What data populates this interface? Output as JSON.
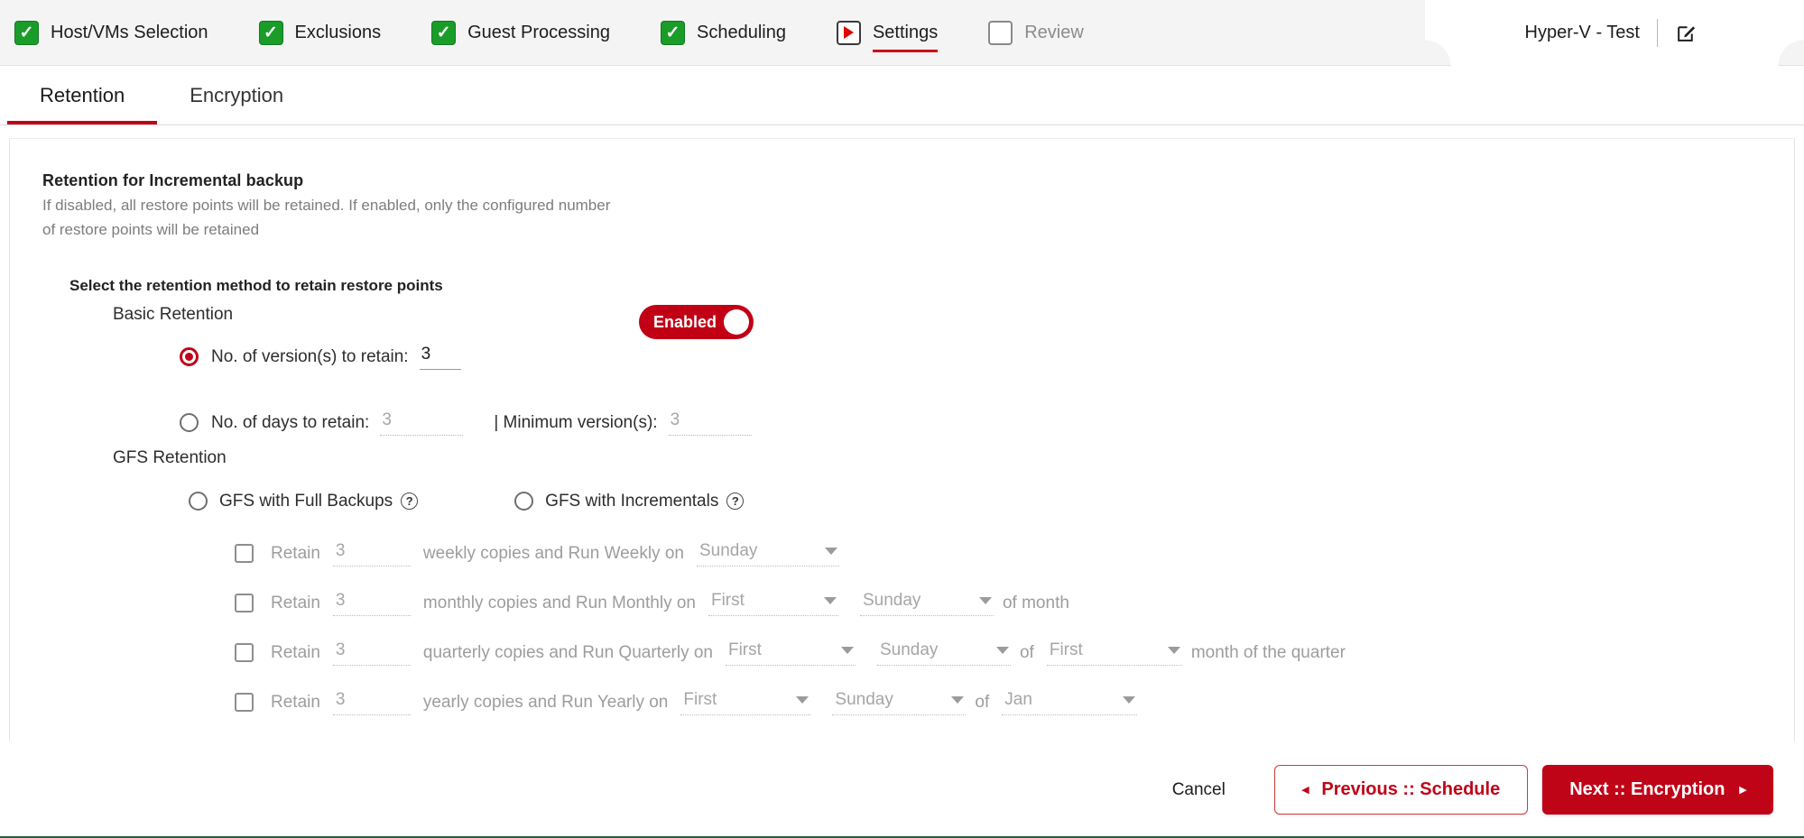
{
  "wizard": {
    "steps": [
      {
        "label": "Host/VMs Selection",
        "state": "done",
        "icon": "check-icon"
      },
      {
        "label": "Exclusions",
        "state": "done",
        "icon": "check-icon"
      },
      {
        "label": "Guest Processing",
        "state": "done",
        "icon": "check-icon"
      },
      {
        "label": "Scheduling",
        "state": "done",
        "icon": "check-icon"
      },
      {
        "label": "Settings",
        "state": "current",
        "icon": "play-icon"
      },
      {
        "label": "Review",
        "state": "empty",
        "icon": "empty-box-icon"
      }
    ],
    "profile": {
      "name": "Hyper-V - Test",
      "edit_icon": "edit-pencil-icon"
    }
  },
  "subtabs": [
    {
      "label": "Retention",
      "active": true
    },
    {
      "label": "Encryption",
      "active": false
    }
  ],
  "retention": {
    "title": "Retention for Incremental backup",
    "description": "If disabled, all restore points will be retained. If enabled, only the configured number of restore points will be retained",
    "toggle": {
      "label": "Enabled",
      "state": "on",
      "color": "#c10016"
    },
    "method_title": "Select the retention method to retain restore points",
    "basic": {
      "group_label": "Basic Retention",
      "versions": {
        "label": "No. of version(s) to retain:",
        "value": "3",
        "selected": true
      },
      "days": {
        "label": "No. of days to retain:",
        "value": "3",
        "selected": false,
        "separator": "| Minimum version(s):",
        "min_versions": "3"
      }
    },
    "gfs": {
      "group_label": "GFS Retention",
      "options": [
        {
          "label": "GFS with Full Backups",
          "help": "?",
          "selected": false
        },
        {
          "label": "GFS with Incrementals",
          "help": "?",
          "selected": false
        }
      ],
      "rows": [
        {
          "retain_label": "Retain",
          "count": "3",
          "text": "weekly copies and Run Weekly on",
          "checked": false,
          "dropdowns": [
            {
              "value": "Sunday",
              "width": "dd-w-week"
            }
          ],
          "suffix": ""
        },
        {
          "retain_label": "Retain",
          "count": "3",
          "text": "monthly copies and Run Monthly on",
          "checked": false,
          "dropdowns": [
            {
              "value": "First",
              "width": "dd-w-ord"
            },
            {
              "value": "Sunday",
              "width": "dd-w-day"
            }
          ],
          "suffix": "of month"
        },
        {
          "retain_label": "Retain",
          "count": "3",
          "text": "quarterly copies and Run Quarterly on",
          "checked": false,
          "dropdowns": [
            {
              "value": "First",
              "width": "dd-w-ord"
            },
            {
              "value": "Sunday",
              "width": "dd-w-day"
            }
          ],
          "mid": "of",
          "dropdowns2": [
            {
              "value": "First",
              "width": "dd-w-mon"
            }
          ],
          "suffix": "month of the quarter"
        },
        {
          "retain_label": "Retain",
          "count": "3",
          "text": "yearly copies and Run Yearly on",
          "checked": false,
          "dropdowns": [
            {
              "value": "First",
              "width": "dd-w-ord"
            },
            {
              "value": "Sunday",
              "width": "dd-w-day"
            }
          ],
          "mid": "of",
          "dropdowns2": [
            {
              "value": "Jan",
              "width": "dd-w-mon"
            }
          ],
          "suffix": ""
        }
      ]
    }
  },
  "footer": {
    "cancel": "Cancel",
    "previous": "Previous :: Schedule",
    "next": "Next :: Encryption",
    "prev_caret": "◂",
    "next_caret": "▸"
  }
}
